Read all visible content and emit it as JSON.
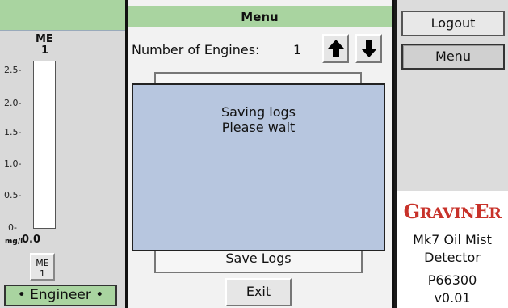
{
  "left_panel": {
    "channel_header": "ME",
    "channel_number": "1",
    "scale_ticks": [
      "2.5-",
      "2.0-",
      "1.5-",
      "1.0-",
      "0.5-",
      "0-"
    ],
    "unit": "mg/l",
    "value": "0.0",
    "gauge_level": 0.0,
    "me_button": {
      "label": "ME",
      "number": "1"
    },
    "role_badge": "• Engineer •"
  },
  "menu": {
    "title": "Menu",
    "engines_label": "Number of Engines:",
    "engines_value": "1",
    "save_logs_label": "Save Logs",
    "exit_label": "Exit"
  },
  "modal": {
    "line1": "Saving logs",
    "line2": "Please wait"
  },
  "right_panel": {
    "logout_label": "Logout",
    "menu_label": "Menu",
    "brand_first": "G",
    "brand_mid": "RAVIN",
    "brand_e": "E",
    "brand_last": "R",
    "product_line1": "Mk7 Oil Mist",
    "product_line2": "Detector",
    "part_number": "P66300",
    "version": "v0.01"
  },
  "colors": {
    "header_green": "#a9d4a0",
    "modal_blue": "#b7c6df",
    "brand_red": "#c8322a"
  },
  "icons": {
    "up": "arrow-up-icon",
    "down": "arrow-down-icon"
  }
}
